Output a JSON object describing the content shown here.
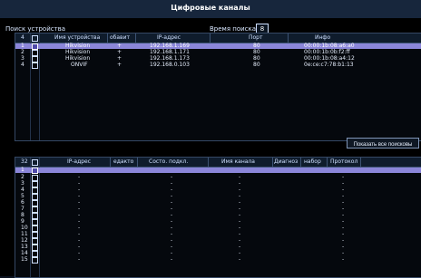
{
  "app": {
    "title": "Цифровые каналы"
  },
  "search": {
    "label": "Поиск устройства",
    "time_label": "Время поиска",
    "time_value": "8"
  },
  "table1": {
    "headers": {
      "num": "4",
      "device": "Имя устройства",
      "add": "обавит",
      "ip": "IP-адрес",
      "port": "Порт",
      "info": "Инфо"
    },
    "rows": [
      {
        "num": "1",
        "device": "Hikvision",
        "add": "+",
        "ip": "192.168.1.169",
        "port": "80",
        "info": "00:00:1b:08:a6:a0"
      },
      {
        "num": "2",
        "device": "Hikvision",
        "add": "+",
        "ip": "192.168.1.171",
        "port": "80",
        "info": "00:00:1b:0b:f2:ff"
      },
      {
        "num": "3",
        "device": "Hikvision",
        "add": "+",
        "ip": "192.168.1.173",
        "port": "80",
        "info": "00:00:1b:08:a4:12"
      },
      {
        "num": "4",
        "device": "ONVIF",
        "add": "+",
        "ip": "192.168.0.103",
        "port": "80",
        "info": "0e:ce:c7:78:b1:13"
      }
    ]
  },
  "show_all_button": {
    "label": "Показать все поисковы"
  },
  "table2": {
    "headers": {
      "num": "32",
      "ip": "IP-адрес",
      "edit": "едакто",
      "state": "Состо. подкл.",
      "channel": "Имя канала",
      "diag": "Диагноз",
      "set": "набор",
      "proto": "Протокол"
    },
    "rows": [
      {
        "num": "1",
        "ip": "",
        "state": "",
        "channel": "",
        "proto": ""
      },
      {
        "num": "2",
        "ip": "-",
        "state": "-",
        "channel": "-",
        "proto": "-"
      },
      {
        "num": "3",
        "ip": "-",
        "state": "-",
        "channel": "-",
        "proto": "-"
      },
      {
        "num": "4",
        "ip": "-",
        "state": "-",
        "channel": "-",
        "proto": "-"
      },
      {
        "num": "5",
        "ip": "-",
        "state": "-",
        "channel": "-",
        "proto": "-"
      },
      {
        "num": "6",
        "ip": "-",
        "state": "-",
        "channel": "-",
        "proto": "-"
      },
      {
        "num": "7",
        "ip": "-",
        "state": "-",
        "channel": "-",
        "proto": "-"
      },
      {
        "num": "8",
        "ip": "-",
        "state": "-",
        "channel": "-",
        "proto": "-"
      },
      {
        "num": "9",
        "ip": "-",
        "state": "-",
        "channel": "-",
        "proto": "-"
      },
      {
        "num": "10",
        "ip": "-",
        "state": "-",
        "channel": "-",
        "proto": "-"
      },
      {
        "num": "11",
        "ip": "-",
        "state": "-",
        "channel": "-",
        "proto": "-"
      },
      {
        "num": "12",
        "ip": "-",
        "state": "-",
        "channel": "-",
        "proto": "-"
      },
      {
        "num": "13",
        "ip": "-",
        "state": "-",
        "channel": "-",
        "proto": "-"
      },
      {
        "num": "14",
        "ip": "-",
        "state": "-",
        "channel": "-",
        "proto": "-"
      },
      {
        "num": "15",
        "ip": "-",
        "state": "-",
        "channel": "-",
        "proto": "-"
      }
    ]
  }
}
